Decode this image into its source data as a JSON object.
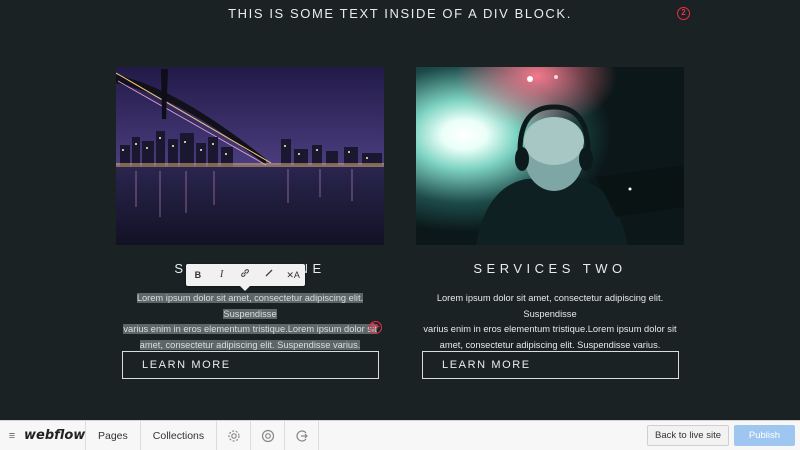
{
  "canvas": {
    "top_text": "THIS IS SOME TEXT INSIDE OF A DIV BLOCK.",
    "top_badge": "2",
    "cards": [
      {
        "title": "SERVICES ONE",
        "body_lines": [
          "Lorem ipsum dolor sit amet, consectetur adipiscing elit. Suspendisse",
          "varius enim in eros elementum tristique.Lorem ipsum dolor sit",
          "amet, consectetur adipiscing elit. Suspendisse varius."
        ],
        "button": "LEARN MORE",
        "image": "night-bridge-photo"
      },
      {
        "title": "SERVICES TWO",
        "body_lines": [
          "Lorem ipsum dolor sit amet, consectetur adipiscing elit. Suspendisse",
          "varius enim in eros elementum tristique.Lorem ipsum dolor sit",
          "amet, consectetur adipiscing elit. Suspendisse varius."
        ],
        "button": "LEARN MORE",
        "image": "dj-headphones-photo"
      }
    ],
    "text_badge": "9+"
  },
  "toolbar_rte": {
    "bold": "B",
    "italic": "I",
    "link_icon": "link-icon",
    "brush_icon": "brush-icon",
    "clear_format": "✕A"
  },
  "bottom_bar": {
    "logo": "webflow",
    "pages": "Pages",
    "collections": "Collections",
    "icons": [
      "gear-icon",
      "help-icon",
      "share-icon"
    ],
    "back_button": "Back to live site",
    "publish_button": "Publish"
  },
  "colors": {
    "background": "#1b2224",
    "accent_red": "#e8304a",
    "publish_blue": "#9fc6f0"
  }
}
